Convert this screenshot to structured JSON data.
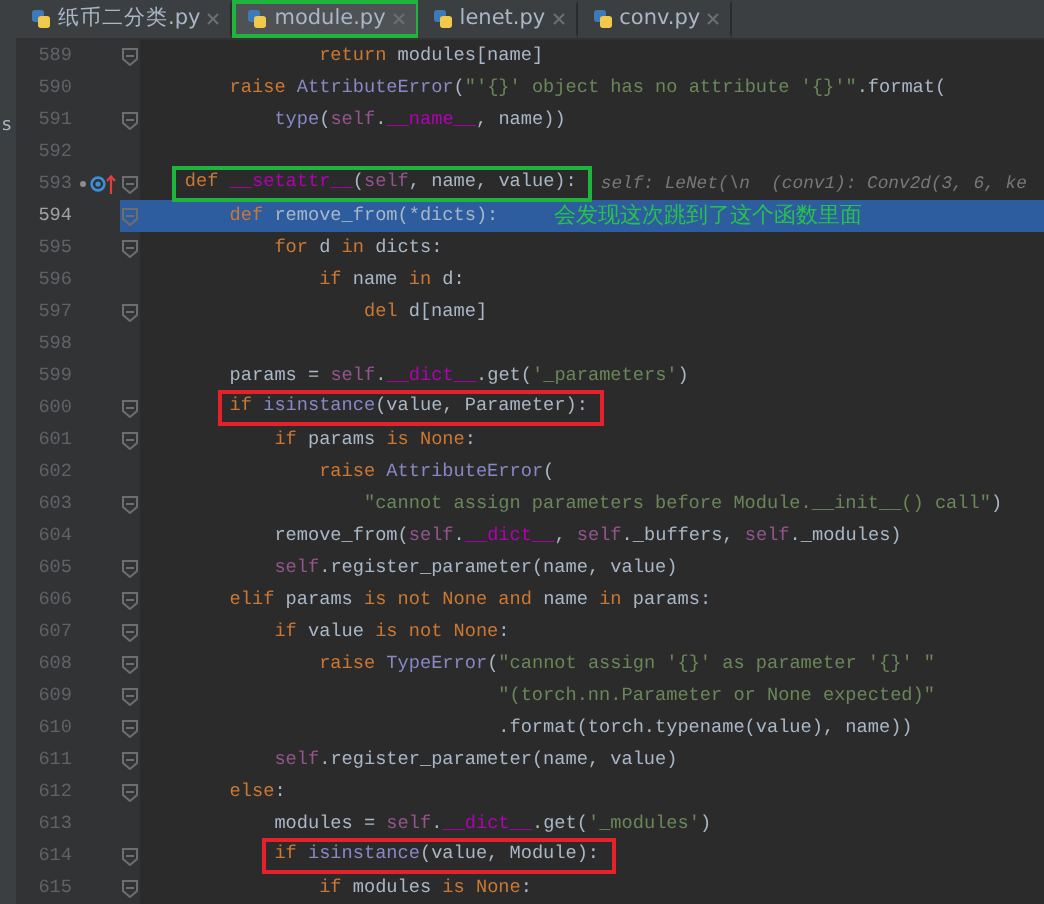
{
  "sidebar_edge_text": "s",
  "tabs": [
    {
      "label": "纸币二分类.py",
      "selected": false
    },
    {
      "label": "module.py",
      "selected": true,
      "color": "#1fb53c"
    },
    {
      "label": "lenet.py",
      "selected": false
    },
    {
      "label": "conv.py",
      "selected": false
    }
  ],
  "lines": [
    {
      "number": "589",
      "fold": true,
      "current": false,
      "overrides": false,
      "tokens": [
        {
          "kind": "keyword",
          "text": "                return"
        },
        {
          "kind": "plain",
          "text": " modules[name]"
        }
      ]
    },
    {
      "number": "590",
      "fold": false,
      "current": false,
      "overrides": false,
      "tokens": [
        {
          "kind": "keyword",
          "text": "        raise"
        },
        {
          "kind": "builtin",
          "text": " AttributeError"
        },
        {
          "kind": "plain",
          "text": "("
        },
        {
          "kind": "string",
          "text": "\"'{}' object has no attribute '{}'\""
        },
        {
          "kind": "plain",
          "text": ".format("
        }
      ]
    },
    {
      "number": "591",
      "fold": true,
      "current": false,
      "overrides": false,
      "tokens": [
        {
          "kind": "builtin",
          "text": "            type"
        },
        {
          "kind": "plain",
          "text": "("
        },
        {
          "kind": "self",
          "text": "self"
        },
        {
          "kind": "plain",
          "text": "."
        },
        {
          "kind": "magic",
          "text": "__name__"
        },
        {
          "kind": "plain",
          "text": ", name))"
        }
      ]
    },
    {
      "number": "592",
      "fold": false,
      "current": false,
      "overrides": false
    },
    {
      "number": "593",
      "fold": true,
      "current": false,
      "overrides": true,
      "color": "#1fb53c",
      "tokens": [
        {
          "kind": "keyword",
          "text": "    def"
        },
        {
          "kind": "magic",
          "text": " __setattr__"
        },
        {
          "kind": "plain",
          "text": "("
        },
        {
          "kind": "self",
          "text": "self"
        },
        {
          "kind": "plain",
          "text": ", name, value):"
        }
      ],
      "hint": "self: LeNet(\\n  (conv1): Conv2d(3, 6, ke"
    },
    {
      "number": "594",
      "fold": true,
      "current": true,
      "overrides": false,
      "tokens": [
        {
          "kind": "keyword",
          "text": "        def"
        },
        {
          "kind": "plain",
          "text": " remove_from(*dicts):"
        }
      ],
      "note": "会发现这次跳到了这个函数里面"
    },
    {
      "number": "595",
      "fold": true,
      "current": false,
      "overrides": false,
      "tokens": [
        {
          "kind": "keyword",
          "text": "            for"
        },
        {
          "kind": "plain",
          "text": " d "
        },
        {
          "kind": "keyword",
          "text": "in"
        },
        {
          "kind": "plain",
          "text": " dicts:"
        }
      ]
    },
    {
      "number": "596",
      "fold": false,
      "current": false,
      "overrides": false,
      "tokens": [
        {
          "kind": "keyword",
          "text": "                if"
        },
        {
          "kind": "plain",
          "text": " name "
        },
        {
          "kind": "keyword",
          "text": "in"
        },
        {
          "kind": "plain",
          "text": " d:"
        }
      ]
    },
    {
      "number": "597",
      "fold": true,
      "current": false,
      "overrides": false,
      "tokens": [
        {
          "kind": "keyword",
          "text": "                    del"
        },
        {
          "kind": "plain",
          "text": " d[name]"
        }
      ]
    },
    {
      "number": "598",
      "fold": false,
      "current": false,
      "overrides": false
    },
    {
      "number": "599",
      "fold": false,
      "current": false,
      "overrides": false,
      "tokens": [
        {
          "kind": "plain",
          "text": "        params = "
        },
        {
          "kind": "self",
          "text": "self"
        },
        {
          "kind": "plain",
          "text": "."
        },
        {
          "kind": "magic",
          "text": "__dict__"
        },
        {
          "kind": "plain",
          "text": ".get("
        },
        {
          "kind": "string",
          "text": "'_parameters'"
        },
        {
          "kind": "plain",
          "text": ")"
        }
      ]
    },
    {
      "number": "600",
      "fold": true,
      "current": false,
      "overrides": false,
      "color": "#e8202a",
      "tokens": [
        {
          "kind": "keyword",
          "text": "        if"
        },
        {
          "kind": "builtin",
          "text": " isinstance"
        },
        {
          "kind": "plain",
          "text": "(value, Parameter):"
        }
      ]
    },
    {
      "number": "601",
      "fold": true,
      "current": false,
      "overrides": false,
      "tokens": [
        {
          "kind": "keyword",
          "text": "            if"
        },
        {
          "kind": "plain",
          "text": " params "
        },
        {
          "kind": "keyword",
          "text": "is None"
        },
        {
          "kind": "plain",
          "text": ":"
        }
      ]
    },
    {
      "number": "602",
      "fold": false,
      "current": false,
      "overrides": false,
      "tokens": [
        {
          "kind": "keyword",
          "text": "                raise"
        },
        {
          "kind": "builtin",
          "text": " AttributeError"
        },
        {
          "kind": "plain",
          "text": "("
        }
      ]
    },
    {
      "number": "603",
      "fold": true,
      "current": false,
      "overrides": false,
      "tokens": [
        {
          "kind": "string",
          "text": "                    \"cannot assign parameters before Module.__init__() call\""
        },
        {
          "kind": "plain",
          "text": ")"
        }
      ]
    },
    {
      "number": "604",
      "fold": false,
      "current": false,
      "overrides": false,
      "tokens": [
        {
          "kind": "plain",
          "text": "            remove_from("
        },
        {
          "kind": "self",
          "text": "self"
        },
        {
          "kind": "plain",
          "text": "."
        },
        {
          "kind": "magic",
          "text": "__dict__"
        },
        {
          "kind": "plain",
          "text": ", "
        },
        {
          "kind": "self",
          "text": "self"
        },
        {
          "kind": "plain",
          "text": "._buffers, "
        },
        {
          "kind": "self",
          "text": "self"
        },
        {
          "kind": "plain",
          "text": "._modules)"
        }
      ]
    },
    {
      "number": "605",
      "fold": true,
      "current": false,
      "overrides": false,
      "tokens": [
        {
          "kind": "self",
          "text": "            self"
        },
        {
          "kind": "plain",
          "text": ".register_parameter(name, value)"
        }
      ]
    },
    {
      "number": "606",
      "fold": true,
      "current": false,
      "overrides": false,
      "tokens": [
        {
          "kind": "keyword",
          "text": "        elif"
        },
        {
          "kind": "plain",
          "text": " params "
        },
        {
          "kind": "keyword",
          "text": "is not None and"
        },
        {
          "kind": "plain",
          "text": " name "
        },
        {
          "kind": "keyword",
          "text": "in"
        },
        {
          "kind": "plain",
          "text": " params:"
        }
      ]
    },
    {
      "number": "607",
      "fold": true,
      "current": false,
      "overrides": false,
      "tokens": [
        {
          "kind": "keyword",
          "text": "            if"
        },
        {
          "kind": "plain",
          "text": " value "
        },
        {
          "kind": "keyword",
          "text": "is not None"
        },
        {
          "kind": "plain",
          "text": ":"
        }
      ]
    },
    {
      "number": "608",
      "fold": true,
      "current": false,
      "overrides": false,
      "tokens": [
        {
          "kind": "keyword",
          "text": "                raise"
        },
        {
          "kind": "builtin",
          "text": " TypeError"
        },
        {
          "kind": "plain",
          "text": "("
        },
        {
          "kind": "string",
          "text": "\"cannot assign '{}' as parameter '{}' \""
        }
      ]
    },
    {
      "number": "609",
      "fold": true,
      "current": false,
      "overrides": false,
      "tokens": [
        {
          "kind": "string",
          "text": "                                \"(torch.nn.Parameter or None expected)\""
        }
      ]
    },
    {
      "number": "610",
      "fold": true,
      "current": false,
      "overrides": false,
      "tokens": [
        {
          "kind": "plain",
          "text": "                                .format(torch.typename(value), name))"
        }
      ]
    },
    {
      "number": "611",
      "fold": true,
      "current": false,
      "overrides": false,
      "tokens": [
        {
          "kind": "self",
          "text": "            self"
        },
        {
          "kind": "plain",
          "text": ".register_parameter(name, value)"
        }
      ]
    },
    {
      "number": "612",
      "fold": true,
      "current": false,
      "overrides": false,
      "tokens": [
        {
          "kind": "keyword",
          "text": "        else"
        },
        {
          "kind": "plain",
          "text": ":"
        }
      ]
    },
    {
      "number": "613",
      "fold": false,
      "current": false,
      "overrides": false,
      "tokens": [
        {
          "kind": "plain",
          "text": "            modules = "
        },
        {
          "kind": "self",
          "text": "self"
        },
        {
          "kind": "plain",
          "text": "."
        },
        {
          "kind": "magic",
          "text": "__dict__"
        },
        {
          "kind": "plain",
          "text": ".get("
        },
        {
          "kind": "string",
          "text": "'_modules'"
        },
        {
          "kind": "plain",
          "text": ")"
        }
      ]
    },
    {
      "number": "614",
      "fold": true,
      "current": false,
      "overrides": false,
      "color": "#e8202a",
      "tokens": [
        {
          "kind": "keyword",
          "text": "            if"
        },
        {
          "kind": "builtin",
          "text": " isinstance"
        },
        {
          "kind": "plain",
          "text": "(value, Module):"
        }
      ]
    },
    {
      "number": "615",
      "fold": true,
      "current": false,
      "overrides": false,
      "tokens": [
        {
          "kind": "keyword",
          "text": "                if"
        },
        {
          "kind": "plain",
          "text": " modules "
        },
        {
          "kind": "keyword",
          "text": "is None"
        },
        {
          "kind": "plain",
          "text": ":"
        }
      ]
    }
  ]
}
